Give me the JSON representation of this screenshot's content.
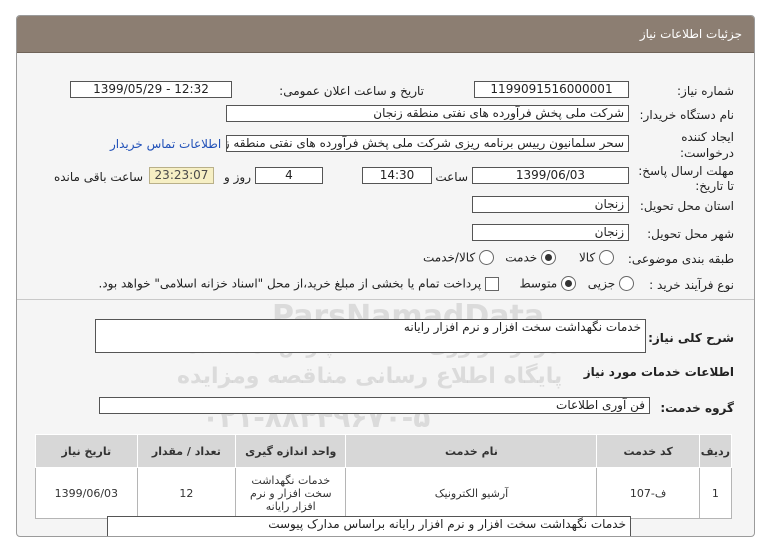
{
  "header": {
    "title": "جزئیات اطلاعات نیاز"
  },
  "need_number": {
    "label": "شماره نیاز:",
    "value": "1199091516000001"
  },
  "announce": {
    "label": "تاریخ و ساعت اعلان عمومی:",
    "value": "1399/05/29 - 12:32"
  },
  "buyer_org": {
    "label": "نام دستگاه خریدار:",
    "value": "شرکت ملی پخش فرآورده های نفتی منطقه زنجان"
  },
  "requester": {
    "label_line1": "ایجاد کننده",
    "label_line2": "درخواست:",
    "value": "سحر سلمانیون رییس برنامه ریزی شرکت ملی پخش فرآورده های نفتی منطقه زنجان",
    "contact_link": "اطلاعات تماس خریدار"
  },
  "deadline": {
    "label_line1": "مهلت ارسال پاسخ:",
    "label_line2": "تا تاریخ:",
    "date": "1399/06/03",
    "time_label": "ساعت",
    "time": "14:30",
    "days": "4",
    "days_label": "روز و",
    "remaining": "23:23:07",
    "remaining_label": "ساعت باقی مانده"
  },
  "province": {
    "label": "استان محل تحویل:",
    "value": "زنجان"
  },
  "city": {
    "label": "شهر محل تحویل:",
    "value": "زنجان"
  },
  "category": {
    "label": "طبقه بندی موضوعی:",
    "options": [
      "کالا",
      "خدمت",
      "کالا/خدمت"
    ],
    "selected": "خدمت"
  },
  "purchase_type": {
    "label": "نوع فرآیند خرید :",
    "options": [
      "جزیی",
      "متوسط"
    ],
    "selected": "متوسط",
    "checkbox_text": "پرداخت تمام یا بخشی از مبلغ خرید،از محل \"اسناد خزانه اسلامی\" خواهد بود."
  },
  "summary": {
    "label": "شرح کلی نیاز:",
    "value": "خدمات نگهداشت سخت افزار و نرم افزار رایانه"
  },
  "services_info": {
    "title": "اطلاعات خدمات مورد نیاز"
  },
  "service_group": {
    "label": "گروه خدمت:",
    "value": "فن آوری اطلاعات"
  },
  "table": {
    "headers": [
      "ردیف",
      "کد خدمت",
      "نام خدمت",
      "واحد اندازه گیری",
      "تعداد / مقدار",
      "تاریخ نیاز"
    ],
    "rows": [
      {
        "row": "1",
        "code": "ف-107",
        "name": "آرشیو الکترونیک",
        "unit": "خدمات نگهداشت سخت افزار و نرم افزار رایانه",
        "qty": "12",
        "date": "1399/06/03"
      }
    ]
  },
  "description": {
    "value": "خدمات نگهداشت سخت افزار و نرم افزار رایانه براساس مدارک پیوست"
  },
  "watermark": {
    "line1": "ParsNamadData",
    "line2": "مرکز فراوری اطلاعات پارس نماد داده",
    "line3": "پایگاه اطلاع رسانی مناقصه ومزایده",
    "line4": "۰۲۱-۸۸۳۴۹۶۷۰-۵"
  }
}
